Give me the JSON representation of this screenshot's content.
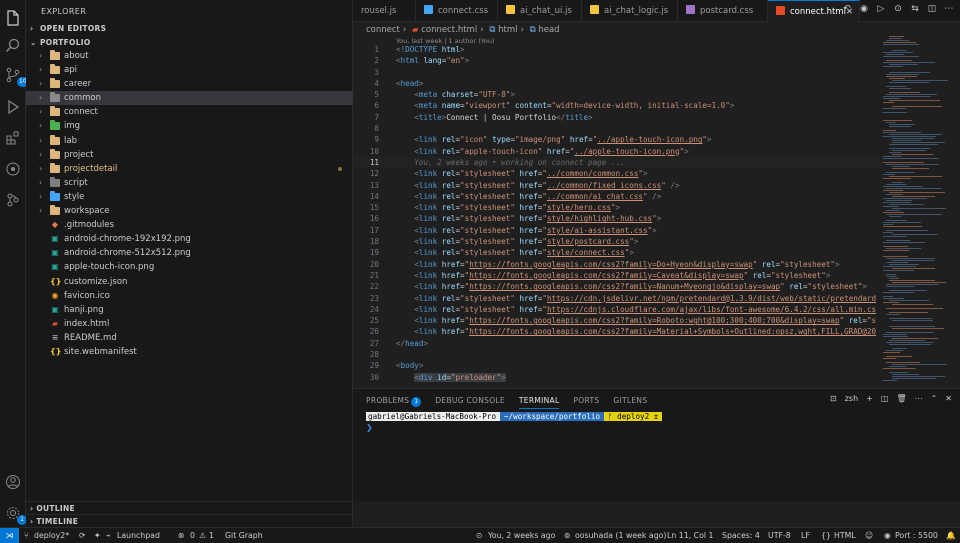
{
  "activity": {
    "source_control_badge": "10",
    "settings_badge": "1"
  },
  "sidebar": {
    "title": "EXPLORER",
    "open_editors": "OPEN EDITORS",
    "project": "PORTFOLIO",
    "items": [
      {
        "name": "about",
        "kind": "folder",
        "color": "#dcb67a"
      },
      {
        "name": "api",
        "kind": "folder",
        "color": "#dcb67a"
      },
      {
        "name": "career",
        "kind": "folder",
        "color": "#dcb67a"
      },
      {
        "name": "common",
        "kind": "folder",
        "color": "#8a8a8a",
        "selected": true
      },
      {
        "name": "connect",
        "kind": "folder",
        "color": "#dcb67a"
      },
      {
        "name": "img",
        "kind": "folder",
        "color": "#4caf50"
      },
      {
        "name": "lab",
        "kind": "folder",
        "color": "#dcb67a"
      },
      {
        "name": "project",
        "kind": "folder",
        "color": "#dcb67a"
      },
      {
        "name": "projectdetail",
        "kind": "folder",
        "color": "#dcb67a",
        "modified": true
      },
      {
        "name": "script",
        "kind": "folder",
        "color": "#7e7e7e"
      },
      {
        "name": "style",
        "kind": "folder",
        "color": "#42a5f5"
      },
      {
        "name": "workspace",
        "kind": "folder",
        "color": "#dcb67a"
      },
      {
        "name": ".gitmodules",
        "kind": "file",
        "glyph": "◆",
        "color": "#e8774a"
      },
      {
        "name": "android-chrome-192x192.png",
        "kind": "file",
        "glyph": "▣",
        "color": "#26a69a"
      },
      {
        "name": "android-chrome-512x512.png",
        "kind": "file",
        "glyph": "▣",
        "color": "#26a69a"
      },
      {
        "name": "apple-touch-icon.png",
        "kind": "file",
        "glyph": "▣",
        "color": "#26a69a"
      },
      {
        "name": "customize.json",
        "kind": "file",
        "glyph": "{}",
        "color": "#f5c542"
      },
      {
        "name": "favicon.ico",
        "kind": "file",
        "glyph": "◉",
        "color": "#f5a623"
      },
      {
        "name": "hanji.png",
        "kind": "file",
        "glyph": "▣",
        "color": "#26a69a"
      },
      {
        "name": "index.html",
        "kind": "file",
        "glyph": "▰",
        "color": "#e44d26"
      },
      {
        "name": "README.md",
        "kind": "file",
        "glyph": "≡",
        "color": "#9e9e9e"
      },
      {
        "name": "site.webmanifest",
        "kind": "file",
        "glyph": "{}",
        "color": "#f5c542"
      }
    ],
    "outline": "OUTLINE",
    "timeline": "TIMELINE"
  },
  "tabs": [
    {
      "label": "rousel.js",
      "color": "#f5c542",
      "active": false
    },
    {
      "label": "connect.css",
      "color": "#42a5f5",
      "active": false
    },
    {
      "label": "ai_chat_ui.js",
      "color": "#f5c542",
      "active": false
    },
    {
      "label": "ai_chat_logic.js",
      "color": "#f5c542",
      "active": false
    },
    {
      "label": "postcard.css",
      "color": "#a074c4",
      "active": false
    },
    {
      "label": "connect.html",
      "color": "#e44d26",
      "active": true
    }
  ],
  "breadcrumb": {
    "folder": "connect",
    "file": "connect.html",
    "node1": "html",
    "node2": "head"
  },
  "blame_header": "You, last week | 1 author (You)",
  "code": [
    {
      "n": "1",
      "html": "<span class=\"t-punct\">&lt;</span><span class=\"t-tag\">!DOCTYPE</span> <span class=\"t-attr\">html</span><span class=\"t-punct\">&gt;</span>"
    },
    {
      "n": "2",
      "html": "<span class=\"t-punct\">&lt;</span><span class=\"t-tag\">html</span> <span class=\"t-attr\">lang</span>=<span class=\"t-str\">\"en\"</span><span class=\"t-punct\">&gt;</span>"
    },
    {
      "n": "3",
      "html": ""
    },
    {
      "n": "4",
      "html": "<span class=\"t-punct\">&lt;</span><span class=\"t-tag\">head</span><span class=\"t-punct\">&gt;</span>"
    },
    {
      "n": "5",
      "html": "    <span class=\"t-punct\">&lt;</span><span class=\"t-tag\">meta</span> <span class=\"t-attr\">charset</span>=<span class=\"t-str\">\"UTF-8\"</span><span class=\"t-punct\">&gt;</span>"
    },
    {
      "n": "6",
      "html": "    <span class=\"t-punct\">&lt;</span><span class=\"t-tag\">meta</span> <span class=\"t-attr\">name</span>=<span class=\"t-str\">\"viewport\"</span> <span class=\"t-attr\">content</span>=<span class=\"t-str\">\"width=device-width, initial-scale=1.0\"</span><span class=\"t-punct\">&gt;</span>"
    },
    {
      "n": "7",
      "html": "    <span class=\"t-punct\">&lt;</span><span class=\"t-tag\">title</span><span class=\"t-punct\">&gt;</span><span class=\"t-txt\">Connect | Oosu Portfolio</span><span class=\"t-punct\">&lt;/</span><span class=\"t-tag\">title</span><span class=\"t-punct\">&gt;</span>"
    },
    {
      "n": "8",
      "html": ""
    },
    {
      "n": "9",
      "html": "    <span class=\"t-punct\">&lt;</span><span class=\"t-tag\">link</span> <span class=\"t-attr\">rel</span>=<span class=\"t-str\">\"icon\"</span> <span class=\"t-attr\">type</span>=<span class=\"t-str\">\"image/png\"</span> <span class=\"t-attr\">href</span>=<span class=\"t-str\">\"</span><span class=\"t-url\">../apple-touch-icon.png</span><span class=\"t-str\">\"</span><span class=\"t-punct\">&gt;</span>"
    },
    {
      "n": "10",
      "html": "    <span class=\"t-punct\">&lt;</span><span class=\"t-tag\">link</span> <span class=\"t-attr\">rel</span>=<span class=\"t-str\">\"apple-touch-icon\"</span> <span class=\"t-attr\">href</span>=<span class=\"t-str\">\"</span><span class=\"t-url\">../apple-touch-icon.png</span><span class=\"t-str\">\"</span><span class=\"t-punct\">&gt;</span>"
    },
    {
      "n": "11",
      "html": "    <span class=\"ghost\">You, 2 weeks ago • working on connect page ...</span>",
      "current": true
    },
    {
      "n": "12",
      "html": "    <span class=\"t-punct\">&lt;</span><span class=\"t-tag\">link</span> <span class=\"t-attr\">rel</span>=<span class=\"t-str\">\"stylesheet\"</span> <span class=\"t-attr\">href</span>=<span class=\"t-str\">\"</span><span class=\"t-url\">../common/common.css</span><span class=\"t-str\">\"</span><span class=\"t-punct\">&gt;</span>"
    },
    {
      "n": "13",
      "html": "    <span class=\"t-punct\">&lt;</span><span class=\"t-tag\">link</span> <span class=\"t-attr\">rel</span>=<span class=\"t-str\">\"stylesheet\"</span> <span class=\"t-attr\">href</span>=<span class=\"t-str\">\"</span><span class=\"t-url\">../common/fixed_icons.css</span><span class=\"t-str\">\"</span> <span class=\"t-punct\">/&gt;</span>"
    },
    {
      "n": "14",
      "html": "    <span class=\"t-punct\">&lt;</span><span class=\"t-tag\">link</span> <span class=\"t-attr\">rel</span>=<span class=\"t-str\">\"stylesheet\"</span> <span class=\"t-attr\">href</span>=<span class=\"t-str\">\"</span><span class=\"t-url\">../common/ai_chat.css</span><span class=\"t-str\">\"</span> <span class=\"t-punct\">/&gt;</span>"
    },
    {
      "n": "15",
      "html": "    <span class=\"t-punct\">&lt;</span><span class=\"t-tag\">link</span> <span class=\"t-attr\">rel</span>=<span class=\"t-str\">\"stylesheet\"</span> <span class=\"t-attr\">href</span>=<span class=\"t-str\">\"</span><span class=\"t-url\">style/hero.css</span><span class=\"t-str\">\"</span><span class=\"t-punct\">&gt;</span>"
    },
    {
      "n": "16",
      "html": "    <span class=\"t-punct\">&lt;</span><span class=\"t-tag\">link</span> <span class=\"t-attr\">rel</span>=<span class=\"t-str\">\"stylesheet\"</span> <span class=\"t-attr\">href</span>=<span class=\"t-str\">\"</span><span class=\"t-url\">style/highlight-hub.css</span><span class=\"t-str\">\"</span><span class=\"t-punct\">&gt;</span>"
    },
    {
      "n": "17",
      "html": "    <span class=\"t-punct\">&lt;</span><span class=\"t-tag\">link</span> <span class=\"t-attr\">rel</span>=<span class=\"t-str\">\"stylesheet\"</span> <span class=\"t-attr\">href</span>=<span class=\"t-str\">\"</span><span class=\"t-url\">style/ai-assistant.css</span><span class=\"t-str\">\"</span><span class=\"t-punct\">&gt;</span>"
    },
    {
      "n": "18",
      "html": "    <span class=\"t-punct\">&lt;</span><span class=\"t-tag\">link</span> <span class=\"t-attr\">rel</span>=<span class=\"t-str\">\"stylesheet\"</span> <span class=\"t-attr\">href</span>=<span class=\"t-str\">\"</span><span class=\"t-url\">style/postcard.css</span><span class=\"t-str\">\"</span><span class=\"t-punct\">&gt;</span>"
    },
    {
      "n": "19",
      "html": "    <span class=\"t-punct\">&lt;</span><span class=\"t-tag\">link</span> <span class=\"t-attr\">rel</span>=<span class=\"t-str\">\"stylesheet\"</span> <span class=\"t-attr\">href</span>=<span class=\"t-str\">\"</span><span class=\"t-url\">style/connect.css</span><span class=\"t-str\">\"</span><span class=\"t-punct\">&gt;</span>"
    },
    {
      "n": "20",
      "html": "    <span class=\"t-punct\">&lt;</span><span class=\"t-tag\">link</span> <span class=\"t-attr\">href</span>=<span class=\"t-str\">\"</span><span class=\"t-url\">https://fonts.googleapis.com/css2?family=Do+Hyeon&amp;display=swap</span><span class=\"t-str\">\"</span> <span class=\"t-attr\">rel</span>=<span class=\"t-str\">\"stylesheet\"</span><span class=\"t-punct\">&gt;</span>"
    },
    {
      "n": "21",
      "html": "    <span class=\"t-punct\">&lt;</span><span class=\"t-tag\">link</span> <span class=\"t-attr\">href</span>=<span class=\"t-str\">\"</span><span class=\"t-url\">https://fonts.googleapis.com/css2?family=Caveat&amp;display=swap</span><span class=\"t-str\">\"</span> <span class=\"t-attr\">rel</span>=<span class=\"t-str\">\"stylesheet\"</span><span class=\"t-punct\">&gt;</span>"
    },
    {
      "n": "22",
      "html": "    <span class=\"t-punct\">&lt;</span><span class=\"t-tag\">link</span> <span class=\"t-attr\">href</span>=<span class=\"t-str\">\"</span><span class=\"t-url\">https://fonts.googleapis.com/css2?family=Nanum+Myeongjo&amp;display=swap</span><span class=\"t-str\">\"</span> <span class=\"t-attr\">rel</span>=<span class=\"t-str\">\"stylesheet\"</span><span class=\"t-punct\">&gt;</span>"
    },
    {
      "n": "23",
      "html": "    <span class=\"t-punct\">&lt;</span><span class=\"t-tag\">link</span> <span class=\"t-attr\">rel</span>=<span class=\"t-str\">\"stylesheet\"</span> <span class=\"t-attr\">href</span>=<span class=\"t-str\">\"</span><span class=\"t-url\">https://cdn.jsdelivr.net/npm/pretendard@1.3.9/dist/web/static/pretendard</span>"
    },
    {
      "n": "24",
      "html": "    <span class=\"t-punct\">&lt;</span><span class=\"t-tag\">link</span> <span class=\"t-attr\">rel</span>=<span class=\"t-str\">\"stylesheet\"</span> <span class=\"t-attr\">href</span>=<span class=\"t-str\">\"</span><span class=\"t-url\">https://cdnjs.cloudflare.com/ajax/libs/font-awesome/6.4.2/css/all.min.cs</span>"
    },
    {
      "n": "25",
      "html": "    <span class=\"t-punct\">&lt;</span><span class=\"t-tag\">link</span> <span class=\"t-attr\">href</span>=<span class=\"t-str\">\"</span><span class=\"t-url\">https://fonts.googleapis.com/css2?family=Roboto:wght@100;300;400;700&amp;display=swap</span><span class=\"t-str\">\"</span> <span class=\"t-attr\">rel</span>=<span class=\"t-str\">\"s</span>"
    },
    {
      "n": "26",
      "html": "    <span class=\"t-punct\">&lt;</span><span class=\"t-tag\">link</span> <span class=\"t-attr\">href</span>=<span class=\"t-str\">\"</span><span class=\"t-url\">https://fonts.googleapis.com/css2?family=Material+Symbols+Outlined:opsz,wght,FILL,GRAD@20</span>"
    },
    {
      "n": "27",
      "html": "<span class=\"t-punct\">&lt;/</span><span class=\"t-tag\">head</span><span class=\"t-punct\">&gt;</span>"
    },
    {
      "n": "28",
      "html": ""
    },
    {
      "n": "29",
      "html": "<span class=\"t-punct\">&lt;</span><span class=\"t-tag\">body</span><span class=\"t-punct\">&gt;</span>"
    },
    {
      "n": "30",
      "html": "    <span class=\"hl-box\"><span class=\"t-punct\">&lt;</span><span class=\"t-tag\">div</span> <span class=\"t-attr\">id</span>=<span class=\"t-str\">\"preloader\"</span><span class=\"t-punct\">&gt;</span></span>"
    }
  ],
  "panel": {
    "tabs": [
      {
        "label": "PROBLEMS",
        "badge": "1",
        "active": false
      },
      {
        "label": "DEBUG CONSOLE",
        "active": false
      },
      {
        "label": "TERMINAL",
        "active": true
      },
      {
        "label": "PORTS",
        "active": false
      },
      {
        "label": "GITLENS",
        "active": false
      }
    ],
    "shell": "zsh",
    "prompt_user": "gabriel@Gabriels-MacBook-Pro",
    "prompt_path": "~/workspace/portfolio",
    "prompt_git": "ᚠ deploy2 ±"
  },
  "status": {
    "branch": "deploy2*",
    "launchpad": "Launchpad",
    "errors": "0",
    "warnings": "1",
    "git_graph": "Git Graph",
    "blame": "You, 2 weeks ago",
    "author": "oosuhada (1 week ago)",
    "position": "Ln 11, Col 1",
    "spaces": "Spaces: 4",
    "encoding": "UTF-8",
    "eol": "LF",
    "language": "HTML",
    "port": "Port : 5500"
  }
}
